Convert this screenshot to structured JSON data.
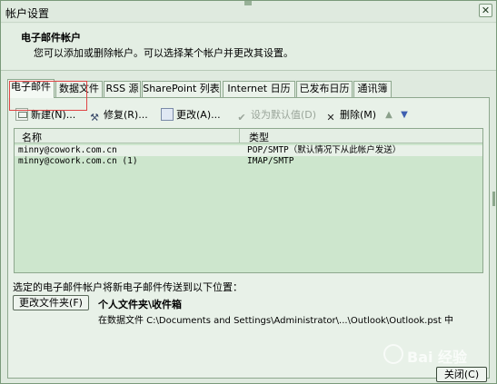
{
  "window": {
    "title": "帐户设置",
    "close_glyph": "✕"
  },
  "header": {
    "title": "电子邮件帐户",
    "description": "您可以添加或删除帐户。可以选择某个帐户并更改其设置。"
  },
  "tabs": [
    {
      "label": "电子邮件",
      "active": true
    },
    {
      "label": "数据文件"
    },
    {
      "label": "RSS 源"
    },
    {
      "label": "SharePoint 列表"
    },
    {
      "label": "Internet 日历"
    },
    {
      "label": "已发布日历"
    },
    {
      "label": "通讯簿"
    }
  ],
  "toolbar": {
    "new_label": "新建(N)...",
    "repair_label": "修复(R)...",
    "change_label": "更改(A)...",
    "set_default_label": "设为默认值(D)",
    "remove_label": "删除(M)",
    "icons": {
      "new": "new-account-icon",
      "repair": "repair-icon",
      "change": "change-icon",
      "set_default": "checkmark-icon",
      "remove": "remove-x-icon",
      "move_up": "up-arrow-icon",
      "move_down": "down-arrow-icon"
    }
  },
  "list": {
    "columns": [
      "名称",
      "类型"
    ],
    "rows": [
      {
        "name": "minny@cowork.com.cn",
        "type": "POP/SMTP（默认情况下从此帐户发送）"
      },
      {
        "name": "minny@cowork.com.cn (1)",
        "type": "IMAP/SMTP"
      }
    ]
  },
  "delivery": {
    "label": "选定的电子邮件帐户将新电子邮件传送到以下位置：",
    "change_folder_label": "更改文件夹(F)",
    "folder_name": "个人文件夹\\收件箱",
    "folder_path": "在数据文件 C:\\Documents and Settings\\Administrator\\...\\Outlook\\Outlook.pst 中"
  },
  "footer": {
    "close_label": "关闭(C)"
  },
  "watermark": {
    "text": "Bai 经验"
  },
  "colors": {
    "selection": "#e04545",
    "list_bg": "#cde6cd"
  }
}
